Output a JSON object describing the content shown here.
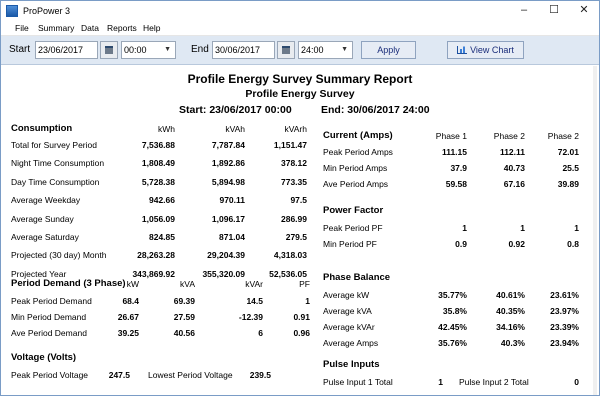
{
  "app": {
    "title": "ProPower 3",
    "min": "–",
    "max": "☐",
    "close": "✕"
  },
  "menu": [
    "File",
    "Summary",
    "Data",
    "Reports",
    "Help"
  ],
  "toolbar": {
    "start_label": "Start",
    "start_date": "23/06/2017",
    "start_time": "00:00",
    "end_label": "End",
    "end_date": "30/06/2017",
    "end_time": "24:00",
    "apply": "Apply",
    "view_chart": "View Chart"
  },
  "report": {
    "title": "Profile Energy Survey Summary Report",
    "subtitle": "Profile Energy Survey",
    "start": "Start: 23/06/2017 00:00",
    "end": "End: 30/06/2017 24:00",
    "consumption": {
      "heading": "Consumption",
      "cols": [
        "kWh",
        "kVAh",
        "kVArh"
      ],
      "rows": [
        [
          "Total for Survey Period",
          "7,536.88",
          "7,787.84",
          "1,151.47"
        ],
        [
          "Night Time Consumption",
          "1,808.49",
          "1,892.86",
          "378.12"
        ],
        [
          "Day Time Consumption",
          "5,728.38",
          "5,894.98",
          "773.35"
        ],
        [
          "Average Weekday",
          "942.66",
          "970.11",
          "97.5"
        ],
        [
          "Average Sunday",
          "1,056.09",
          "1,096.17",
          "286.99"
        ],
        [
          "Average Saturday",
          "824.85",
          "871.04",
          "279.5"
        ],
        [
          "Projected (30 day) Month",
          "28,263.28",
          "29,204.39",
          "4,318.03"
        ],
        [
          "Projected Year",
          "343,869.92",
          "355,320.09",
          "52,536.05"
        ]
      ]
    },
    "period_demand": {
      "heading": "Period Demand (3 Phase)",
      "cols": [
        "kW",
        "kVA",
        "kVAr",
        "PF"
      ],
      "rows": [
        [
          "Peak Period Demand",
          "68.4",
          "69.39",
          "14.5",
          "1"
        ],
        [
          "Min Period Demand",
          "26.67",
          "27.59",
          "-12.39",
          "0.91"
        ],
        [
          "Ave Period Demand",
          "39.25",
          "40.56",
          "6",
          "0.96"
        ]
      ]
    },
    "voltage": {
      "heading": "Voltage (Volts)",
      "peak_label": "Peak Period Voltage",
      "peak": "247.5",
      "low_label": "Lowest Period Voltage",
      "low": "239.5"
    },
    "current": {
      "heading": "Current (Amps)",
      "cols": [
        "Phase 1",
        "Phase 2",
        "Phase 2"
      ],
      "rows": [
        [
          "Peak Period Amps",
          "111.15",
          "112.11",
          "72.01"
        ],
        [
          "Min Period Amps",
          "37.9",
          "40.73",
          "25.5"
        ],
        [
          "Ave Period Amps",
          "59.58",
          "67.16",
          "39.89"
        ]
      ]
    },
    "power_factor": {
      "heading": "Power Factor",
      "rows": [
        [
          "Peak Period PF",
          "1",
          "1",
          "1"
        ],
        [
          "Min Period PF",
          "0.9",
          "0.92",
          "0.8"
        ]
      ]
    },
    "phase_balance": {
      "heading": "Phase Balance",
      "rows": [
        [
          "Average kW",
          "35.77%",
          "40.61%",
          "23.61%"
        ],
        [
          "Average kVA",
          "35.8%",
          "40.35%",
          "23.97%"
        ],
        [
          "Average kVAr",
          "42.45%",
          "34.16%",
          "23.39%"
        ],
        [
          "Average Amps",
          "35.76%",
          "40.3%",
          "23.94%"
        ]
      ]
    },
    "pulse": {
      "heading": "Pulse Inputs",
      "in1_label": "Pulse Input 1 Total",
      "in1": "1",
      "in2_label": "Pulse Input 2 Total",
      "in2": "0"
    }
  }
}
